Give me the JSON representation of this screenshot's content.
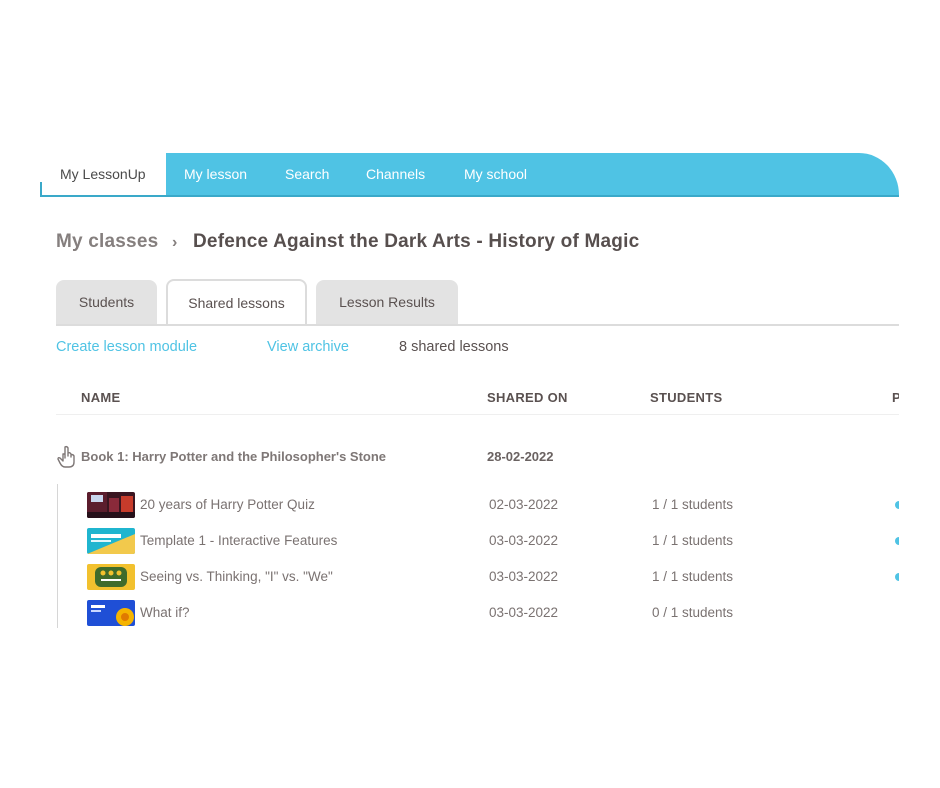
{
  "nav": {
    "home": "My LessonUp",
    "items": [
      "My lesson",
      "Search",
      "Channels",
      "My school"
    ]
  },
  "breadcrumb": {
    "parent": "My classes",
    "separator": "›",
    "current": "Defence Against the Dark Arts - History of Magic"
  },
  "tabs": [
    "Students",
    "Shared lessons",
    "Lesson Results"
  ],
  "active_tab": "Shared lessons",
  "actions": {
    "create": "Create lesson module",
    "archive": "View archive",
    "count": "8 shared lessons"
  },
  "table": {
    "headers": [
      "NAME",
      "SHARED ON",
      "STUDENTS",
      "P"
    ],
    "module": {
      "name": "Book 1: Harry Potter and the Philosopher's Stone",
      "shared_on": "28-02-2022",
      "icon": "hand-pointer-icon"
    },
    "lessons": [
      {
        "title": "20 years of Harry Potter Quiz",
        "shared_on": "02-03-2022",
        "students": "1 / 1 students",
        "status": true
      },
      {
        "title": "Template 1 - Interactive Features",
        "shared_on": "03-03-2022",
        "students": "1 / 1 students",
        "status": true
      },
      {
        "title": "Seeing vs. Thinking, \"I\" vs. \"We\"",
        "shared_on": "03-03-2022",
        "students": "1 / 1 students",
        "status": true
      },
      {
        "title": "What if?",
        "shared_on": "03-03-2022",
        "students": "0 / 1 students",
        "status": false
      }
    ]
  },
  "colors": {
    "accent": "#4fc3e4",
    "text": "#5a5150",
    "tab_inactive": "#e3e3e3"
  }
}
